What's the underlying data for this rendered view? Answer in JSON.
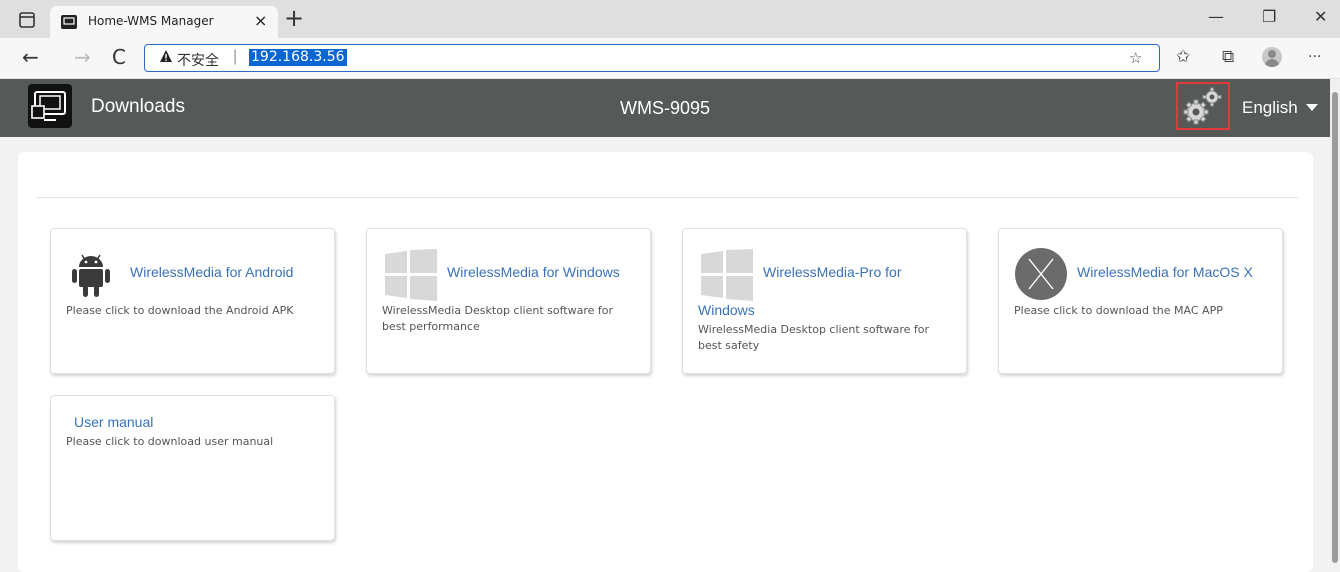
{
  "browser": {
    "tab": {
      "title": "Home-WMS Manager",
      "close": "×"
    },
    "new_tab": "+",
    "window": {
      "minimize": "—",
      "maximize": "❐",
      "close": "✕"
    },
    "nav": {
      "back": "←",
      "forward": "→",
      "refresh": "C"
    },
    "address": {
      "security_label": "不安全",
      "url": "192.168.3.56"
    },
    "toolbar": {
      "favorites_add": "☆",
      "favorites": "✩",
      "collections": "⧉",
      "more": "···"
    }
  },
  "app": {
    "section": "Downloads",
    "device": "WMS-9095",
    "language": "English",
    "settings_icon": "gears-icon"
  },
  "downloads": [
    {
      "icon": "android-icon",
      "title": "WirelessMedia for Android",
      "desc_line1": "Please click to download the Android APK",
      "desc_line2": ""
    },
    {
      "icon": "windows-icon",
      "title": "WirelessMedia for Windows",
      "desc_line1": "WirelessMedia Desktop client software for",
      "desc_line2": "best performance"
    },
    {
      "icon": "windows-icon",
      "title_line1": "WirelessMedia-Pro for",
      "title_line2": "Windows",
      "desc_line1": "WirelessMedia Desktop client software for",
      "desc_line2": "best safety"
    },
    {
      "icon": "macos-x-icon",
      "title": "WirelessMedia for MacOS X",
      "desc_line1": "Please click to download the MAC APP",
      "desc_line2": ""
    },
    {
      "title": "User manual",
      "desc_line1": "Please click to download user manual"
    }
  ],
  "colors": {
    "header_bg": "#555957",
    "link": "#3a72b8",
    "highlight": "#e23a3a",
    "url_selection": "#0a66d1"
  }
}
